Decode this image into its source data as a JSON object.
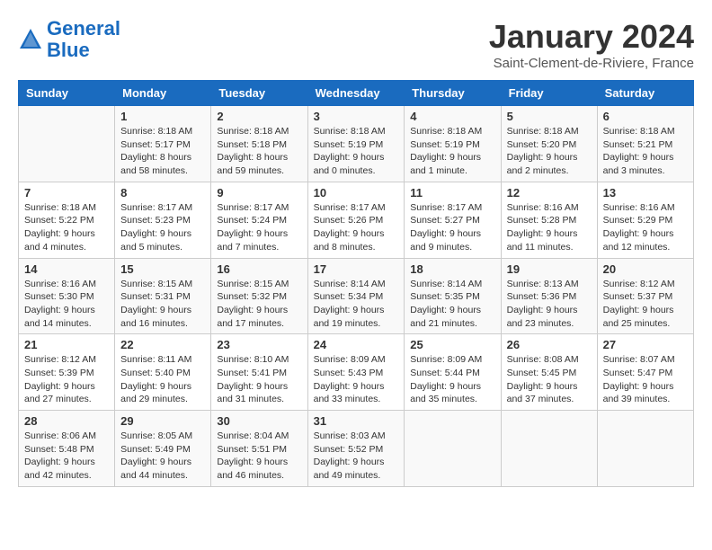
{
  "header": {
    "logo_line1": "General",
    "logo_line2": "Blue",
    "month_title": "January 2024",
    "location": "Saint-Clement-de-Riviere, France"
  },
  "weekdays": [
    "Sunday",
    "Monday",
    "Tuesday",
    "Wednesday",
    "Thursday",
    "Friday",
    "Saturday"
  ],
  "weeks": [
    [
      {
        "day": "",
        "content": ""
      },
      {
        "day": "1",
        "content": "Sunrise: 8:18 AM\nSunset: 5:17 PM\nDaylight: 8 hours\nand 58 minutes."
      },
      {
        "day": "2",
        "content": "Sunrise: 8:18 AM\nSunset: 5:18 PM\nDaylight: 8 hours\nand 59 minutes."
      },
      {
        "day": "3",
        "content": "Sunrise: 8:18 AM\nSunset: 5:19 PM\nDaylight: 9 hours\nand 0 minutes."
      },
      {
        "day": "4",
        "content": "Sunrise: 8:18 AM\nSunset: 5:19 PM\nDaylight: 9 hours\nand 1 minute."
      },
      {
        "day": "5",
        "content": "Sunrise: 8:18 AM\nSunset: 5:20 PM\nDaylight: 9 hours\nand 2 minutes."
      },
      {
        "day": "6",
        "content": "Sunrise: 8:18 AM\nSunset: 5:21 PM\nDaylight: 9 hours\nand 3 minutes."
      }
    ],
    [
      {
        "day": "7",
        "content": "Sunrise: 8:18 AM\nSunset: 5:22 PM\nDaylight: 9 hours\nand 4 minutes."
      },
      {
        "day": "8",
        "content": "Sunrise: 8:17 AM\nSunset: 5:23 PM\nDaylight: 9 hours\nand 5 minutes."
      },
      {
        "day": "9",
        "content": "Sunrise: 8:17 AM\nSunset: 5:24 PM\nDaylight: 9 hours\nand 7 minutes."
      },
      {
        "day": "10",
        "content": "Sunrise: 8:17 AM\nSunset: 5:26 PM\nDaylight: 9 hours\nand 8 minutes."
      },
      {
        "day": "11",
        "content": "Sunrise: 8:17 AM\nSunset: 5:27 PM\nDaylight: 9 hours\nand 9 minutes."
      },
      {
        "day": "12",
        "content": "Sunrise: 8:16 AM\nSunset: 5:28 PM\nDaylight: 9 hours\nand 11 minutes."
      },
      {
        "day": "13",
        "content": "Sunrise: 8:16 AM\nSunset: 5:29 PM\nDaylight: 9 hours\nand 12 minutes."
      }
    ],
    [
      {
        "day": "14",
        "content": "Sunrise: 8:16 AM\nSunset: 5:30 PM\nDaylight: 9 hours\nand 14 minutes."
      },
      {
        "day": "15",
        "content": "Sunrise: 8:15 AM\nSunset: 5:31 PM\nDaylight: 9 hours\nand 16 minutes."
      },
      {
        "day": "16",
        "content": "Sunrise: 8:15 AM\nSunset: 5:32 PM\nDaylight: 9 hours\nand 17 minutes."
      },
      {
        "day": "17",
        "content": "Sunrise: 8:14 AM\nSunset: 5:34 PM\nDaylight: 9 hours\nand 19 minutes."
      },
      {
        "day": "18",
        "content": "Sunrise: 8:14 AM\nSunset: 5:35 PM\nDaylight: 9 hours\nand 21 minutes."
      },
      {
        "day": "19",
        "content": "Sunrise: 8:13 AM\nSunset: 5:36 PM\nDaylight: 9 hours\nand 23 minutes."
      },
      {
        "day": "20",
        "content": "Sunrise: 8:12 AM\nSunset: 5:37 PM\nDaylight: 9 hours\nand 25 minutes."
      }
    ],
    [
      {
        "day": "21",
        "content": "Sunrise: 8:12 AM\nSunset: 5:39 PM\nDaylight: 9 hours\nand 27 minutes."
      },
      {
        "day": "22",
        "content": "Sunrise: 8:11 AM\nSunset: 5:40 PM\nDaylight: 9 hours\nand 29 minutes."
      },
      {
        "day": "23",
        "content": "Sunrise: 8:10 AM\nSunset: 5:41 PM\nDaylight: 9 hours\nand 31 minutes."
      },
      {
        "day": "24",
        "content": "Sunrise: 8:09 AM\nSunset: 5:43 PM\nDaylight: 9 hours\nand 33 minutes."
      },
      {
        "day": "25",
        "content": "Sunrise: 8:09 AM\nSunset: 5:44 PM\nDaylight: 9 hours\nand 35 minutes."
      },
      {
        "day": "26",
        "content": "Sunrise: 8:08 AM\nSunset: 5:45 PM\nDaylight: 9 hours\nand 37 minutes."
      },
      {
        "day": "27",
        "content": "Sunrise: 8:07 AM\nSunset: 5:47 PM\nDaylight: 9 hours\nand 39 minutes."
      }
    ],
    [
      {
        "day": "28",
        "content": "Sunrise: 8:06 AM\nSunset: 5:48 PM\nDaylight: 9 hours\nand 42 minutes."
      },
      {
        "day": "29",
        "content": "Sunrise: 8:05 AM\nSunset: 5:49 PM\nDaylight: 9 hours\nand 44 minutes."
      },
      {
        "day": "30",
        "content": "Sunrise: 8:04 AM\nSunset: 5:51 PM\nDaylight: 9 hours\nand 46 minutes."
      },
      {
        "day": "31",
        "content": "Sunrise: 8:03 AM\nSunset: 5:52 PM\nDaylight: 9 hours\nand 49 minutes."
      },
      {
        "day": "",
        "content": ""
      },
      {
        "day": "",
        "content": ""
      },
      {
        "day": "",
        "content": ""
      }
    ]
  ]
}
